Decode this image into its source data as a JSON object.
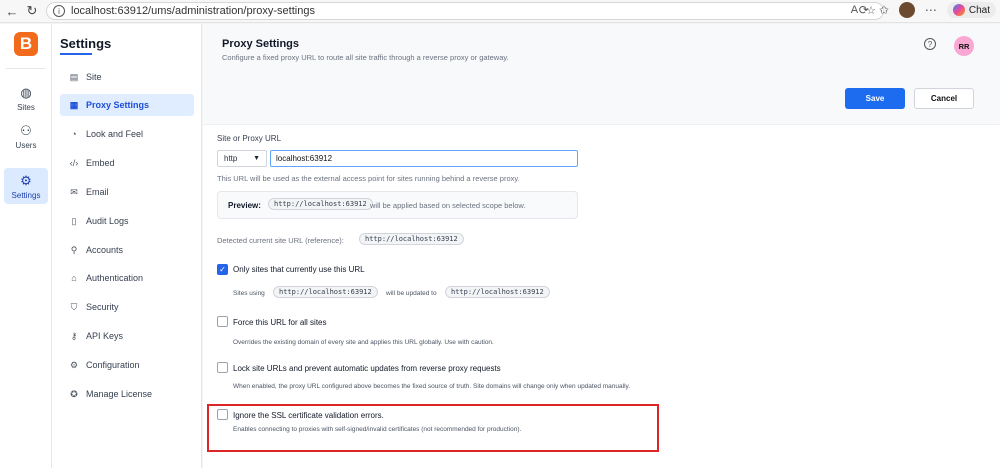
{
  "browser": {
    "url": "localhost:63912/ums/administration/proxy-settings",
    "chat_label": "Chat"
  },
  "rail": {
    "logo": "B",
    "items": [
      {
        "label": "Sites"
      },
      {
        "label": "Users"
      },
      {
        "label": "Settings"
      }
    ]
  },
  "sidebar": {
    "title": "Settings",
    "items": [
      {
        "label": "Site"
      },
      {
        "label": "Proxy Settings"
      },
      {
        "label": "Look and Feel"
      },
      {
        "label": "Embed"
      },
      {
        "label": "Email"
      },
      {
        "label": "Audit Logs"
      },
      {
        "label": "Accounts"
      },
      {
        "label": "Authentication"
      },
      {
        "label": "Security"
      },
      {
        "label": "API Keys"
      },
      {
        "label": "Configuration"
      },
      {
        "label": "Manage License"
      }
    ]
  },
  "header": {
    "title": "Proxy Settings",
    "subtitle": "Configure a fixed proxy URL to route all site traffic through a reverse proxy or gateway.",
    "user_initials": "RR",
    "save_label": "Save",
    "cancel_label": "Cancel"
  },
  "form": {
    "url_label": "Site or Proxy URL",
    "protocol": "http",
    "url_value": "localhost:63912",
    "url_helper": "This URL will be used as the external access point for sites running behind a reverse proxy.",
    "preview_label": "Preview:",
    "preview_url": "http://localhost:63912",
    "preview_suffix": "will be applied based on selected scope below.",
    "detected_label": "Detected current site URL (reference):",
    "detected_url": "http://localhost:63912",
    "options": [
      {
        "label": "Only sites that currently use this URL",
        "checked": true,
        "note_prefix": "Sites using",
        "note_url_from": "http://localhost:63912",
        "note_mid": "will be updated to",
        "note_url_to": "http://localhost:63912"
      },
      {
        "label": "Force this URL for all sites",
        "checked": false,
        "note": "Overrides the existing domain of every site and applies this URL globally. Use with caution."
      },
      {
        "label": "Lock site URLs and prevent automatic updates from reverse proxy requests",
        "checked": false,
        "note": "When enabled, the proxy URL configured above becomes the fixed source of truth. Site domains will change only when updated manually."
      },
      {
        "label": "Ignore the SSL certificate validation errors.",
        "checked": false,
        "note": "Enables connecting to proxies with self-signed/invalid certificates (not recommended for production)."
      }
    ]
  }
}
